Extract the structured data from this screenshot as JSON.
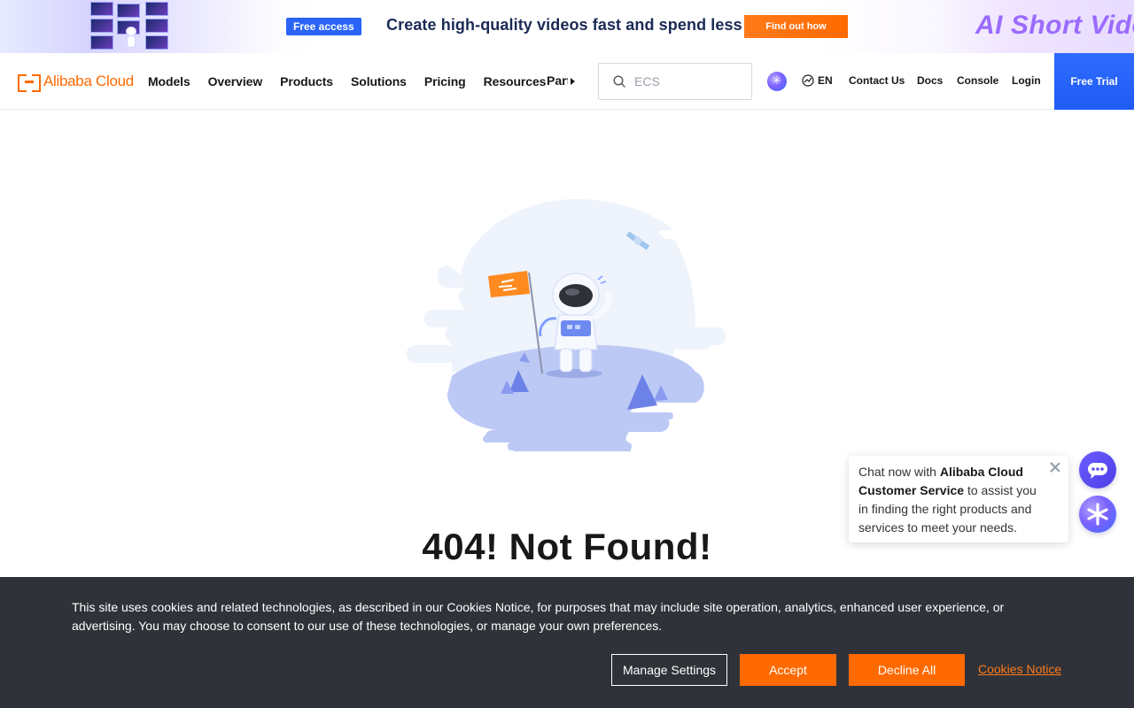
{
  "promo": {
    "badge": "Free access",
    "headline": "Create high-quality videos fast and spend less",
    "cta": "Find out how",
    "brand_text": "AI Short Video"
  },
  "header": {
    "logo_text": "Alibaba Cloud",
    "nav": [
      "Models",
      "Overview",
      "Products",
      "Solutions",
      "Pricing",
      "Resources"
    ],
    "nav_more": "Partners",
    "search": {
      "placeholder": "ECS"
    },
    "language": "EN",
    "links": {
      "contact": "Contact Us",
      "docs": "Docs",
      "console": "Console",
      "login": "Login"
    },
    "free_trial": "Free Trial"
  },
  "main": {
    "title": "404! Not Found!"
  },
  "chat": {
    "prefix": "Chat now with ",
    "brand": "Alibaba Cloud Customer Service",
    "suffix": " to assist you in finding the right products and services to meet your needs."
  },
  "cookies": {
    "text": "This site uses cookies and related technologies, as described in our Cookies Notice, for purposes that may include site operation, analytics, enhanced user experience, or advertising. You may choose to consent to our use of these technologies, or manage your own preferences.",
    "manage": "Manage Settings",
    "accept": "Accept",
    "decline": "Decline All",
    "notice_link": "Cookies Notice"
  },
  "colors": {
    "brand_orange": "#ff6a00",
    "primary_blue": "#1f5cf5",
    "cookie_bg": "#2f3238"
  }
}
